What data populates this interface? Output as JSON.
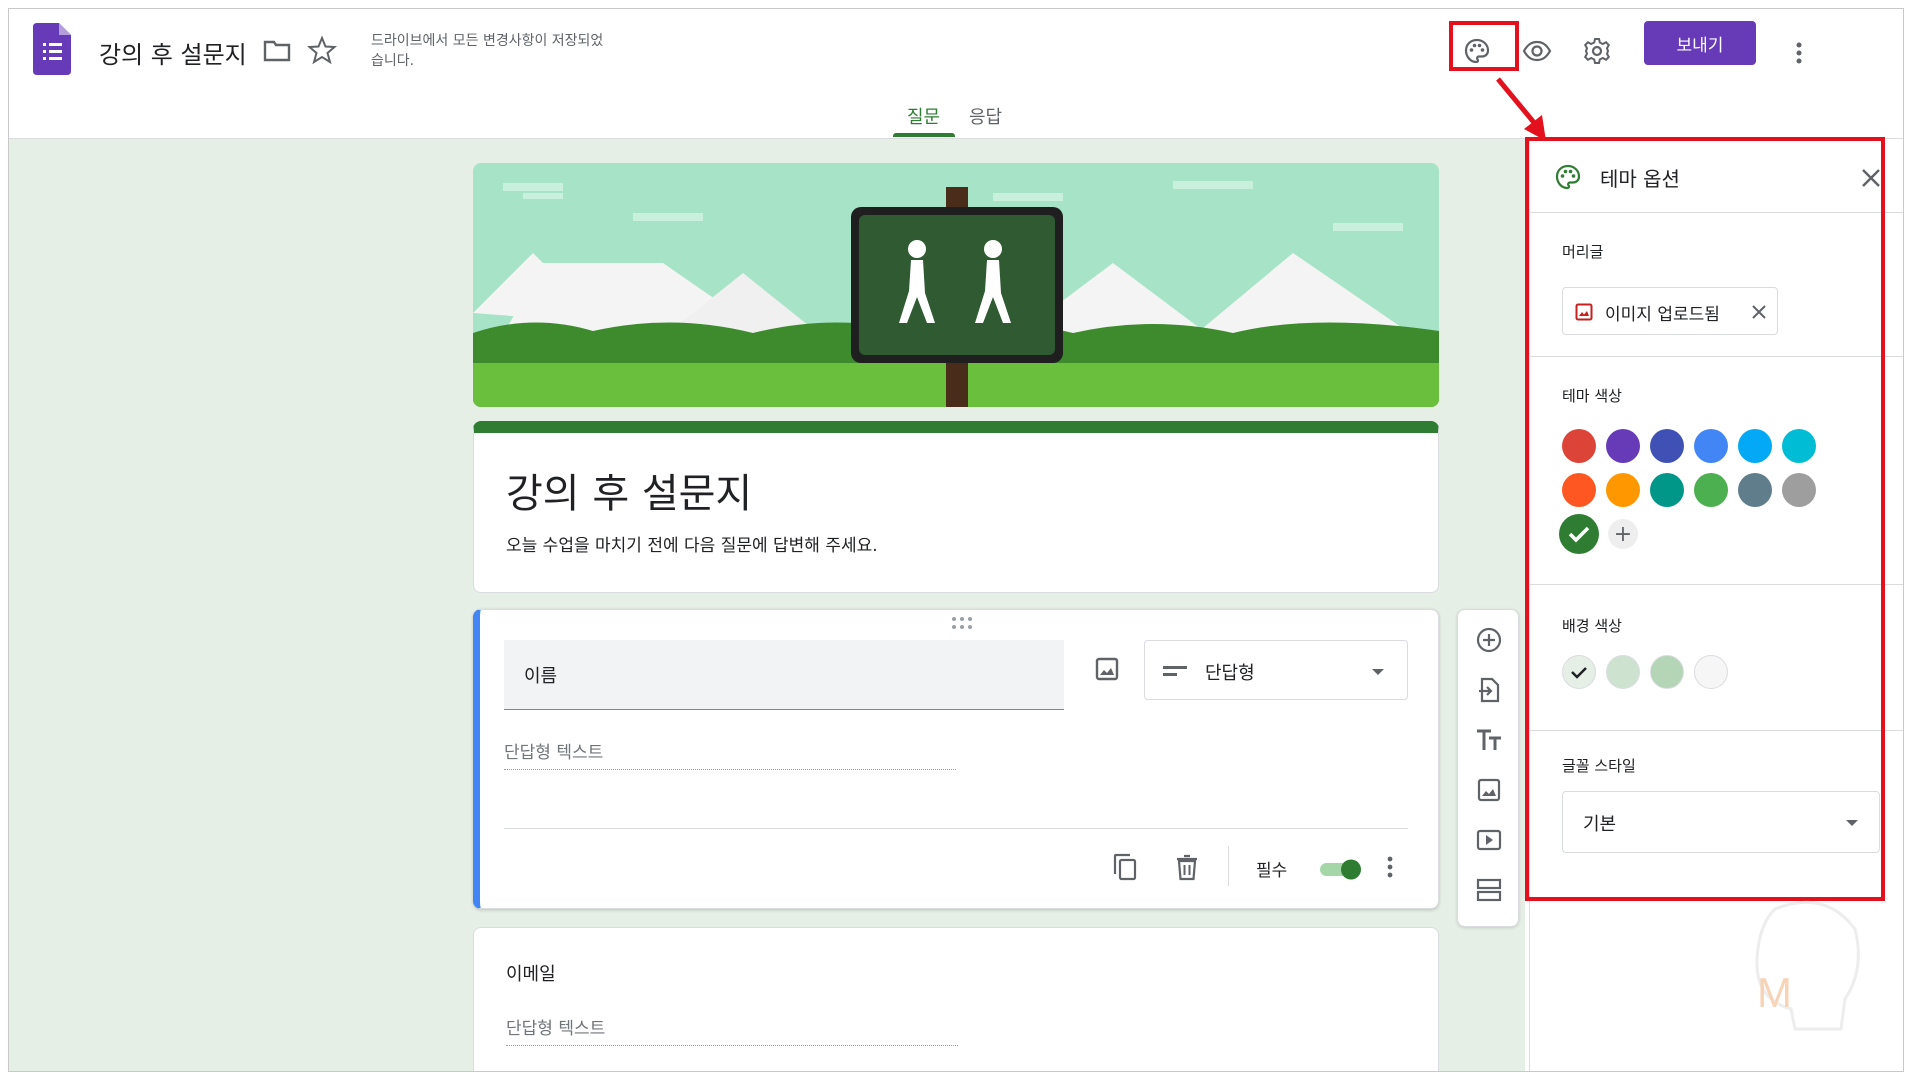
{
  "header": {
    "doc_title": "강의 후 설문지",
    "save_status": "드라이브에서 모든 변경사항이 저장되었습니다.",
    "send_label": "보내기",
    "brand_color": "#673ab7"
  },
  "tabs": [
    {
      "label": "질문",
      "active": true
    },
    {
      "label": "응답",
      "active": false
    }
  ],
  "form": {
    "title": "강의 후 설문지",
    "description": "오늘 수업을 마치기 전에 다음 질문에 답변해 주세요.",
    "theme_color": "#2e7d32",
    "background_color": "#e6efe6"
  },
  "question": {
    "title": "이름",
    "type_label": "단답형",
    "answer_placeholder": "단답형 텍스트",
    "required_label": "필수",
    "required_on": true
  },
  "question2": {
    "title": "이메일",
    "answer_placeholder": "단답형 텍스트"
  },
  "toolbar_icons": [
    "add-question-icon",
    "import-questions-icon",
    "add-title-icon",
    "add-image-icon",
    "add-video-icon",
    "add-section-icon"
  ],
  "theme_panel": {
    "title": "테마 옵션",
    "header_label": "머리글",
    "upload_chip": "이미지 업로드됨",
    "theme_color_label": "테마 색상",
    "theme_colors": [
      "#db4437",
      "#673ab7",
      "#3f51b5",
      "#4285f4",
      "#03a9f4",
      "#00bcd4",
      "#ff5722",
      "#ff9800",
      "#009688",
      "#4caf50",
      "#607d8b",
      "#9e9e9e",
      "#2e7d32"
    ],
    "selected_theme_color": "#2e7d32",
    "background_color_label": "배경 색상",
    "background_colors": [
      "#e6efe6",
      "#cde3cf",
      "#b4d6b7",
      "#f6f6f6"
    ],
    "selected_background_index": 0,
    "font_style_label": "글꼴 스타일",
    "font_style_value": "기본"
  },
  "highlight_color": "#e3101e"
}
